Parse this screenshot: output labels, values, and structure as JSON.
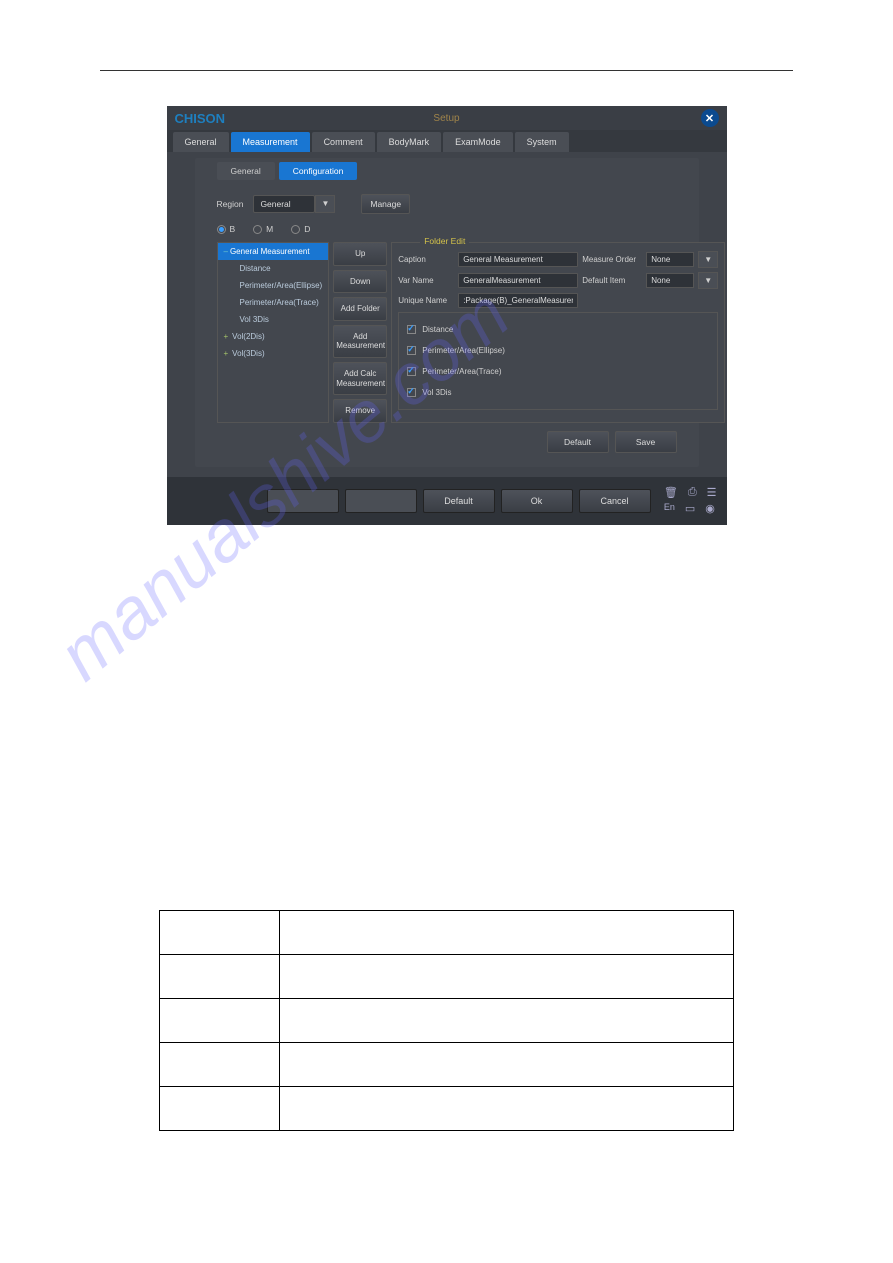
{
  "title": "Setup",
  "brand": "CHISON",
  "main_tabs": [
    "General",
    "Measurement",
    "Comment",
    "BodyMark",
    "ExamMode",
    "System"
  ],
  "main_tab_active": 1,
  "sub_tabs": [
    "General",
    "Configuration"
  ],
  "sub_tab_active": 1,
  "region_label": "Region",
  "region_value": "General",
  "manage_label": "Manage",
  "radios": [
    "B",
    "M",
    "D"
  ],
  "radio_selected": 0,
  "tree": [
    {
      "label": "General Measurement",
      "type": "sel",
      "expander": "–"
    },
    {
      "label": "Distance",
      "type": "child"
    },
    {
      "label": "Perimeter/Area(Ellipse)",
      "type": "child"
    },
    {
      "label": "Perimeter/Area(Trace)",
      "type": "child"
    },
    {
      "label": "Vol 3Dis",
      "type": "child"
    },
    {
      "label": "Vol(2Dis)",
      "type": "plus"
    },
    {
      "label": "Vol(3Dis)",
      "type": "plus"
    }
  ],
  "btn_col": [
    "Up",
    "Down",
    "Add Folder",
    "Add Measurement",
    "Add Calc Measurement",
    "Remove"
  ],
  "folder_edit_label": "Folder Edit",
  "form": {
    "caption_lbl": "Caption",
    "caption_val": "General Measurement",
    "measure_order_lbl": "Measure Order",
    "measure_order_val": "None",
    "varname_lbl": "Var Name",
    "varname_val": "GeneralMeasurement",
    "default_item_lbl": "Default Item",
    "default_item_val": "None",
    "unique_lbl": "Unique Name",
    "unique_val": ":Package(B)_GeneralMeasurement"
  },
  "checks": [
    "Distance",
    "Perimeter/Area(Ellipse)",
    "Perimeter/Area(Trace)",
    "Vol 3Dis"
  ],
  "default_btn": "Default",
  "save_btn": "Save",
  "footer_btns": [
    "",
    "",
    "Default",
    "Ok",
    "Cancel"
  ],
  "footer_lang": "En",
  "watermark": "manualshive.com"
}
